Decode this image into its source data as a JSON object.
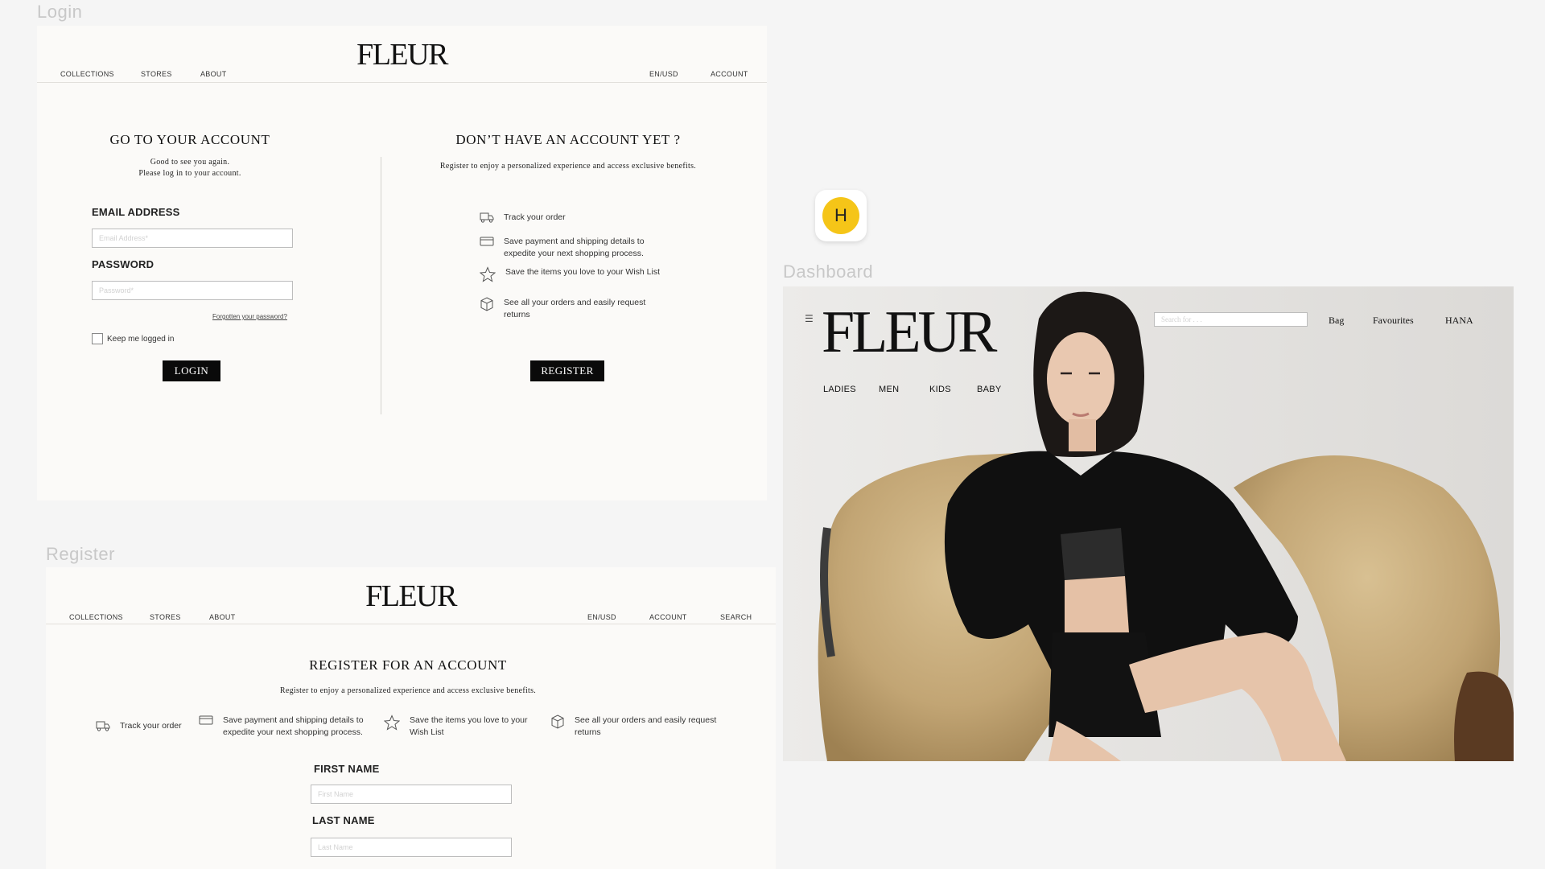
{
  "labels": {
    "login_frame": "Login",
    "register_frame": "Register",
    "dashboard_frame": "Dashboard"
  },
  "avatar": {
    "initial": "H",
    "color": "#f5c518"
  },
  "brand": {
    "logo": "FLEUR"
  },
  "login_page": {
    "nav_left": [
      "COLLECTIONS",
      "STORES",
      "ABOUT"
    ],
    "nav_right": [
      "EN/USD",
      "ACCOUNT"
    ],
    "login": {
      "title": "GO TO YOUR ACCOUNT",
      "subtitle_line1": "Good to see you again.",
      "subtitle_line2": "Please log in to your account.",
      "email_label": "EMAIL ADDRESS",
      "email_placeholder": "Email Address*",
      "password_label": "PASSWORD",
      "password_placeholder": "Password*",
      "forgot": "Forgotten your password?",
      "keep_logged": "Keep me logged in",
      "button": "LOGIN"
    },
    "signup": {
      "title": "DON’T HAVE AN ACCOUNT YET ?",
      "subtitle": "Register to enjoy a personalized experience and access exclusive benefits.",
      "benefits": [
        {
          "icon": "truck-icon",
          "text": "Track your order"
        },
        {
          "icon": "card-icon",
          "text": "Save payment and shipping details to expedite your next shopping process."
        },
        {
          "icon": "star-icon",
          "text": "Save the items you love to your Wish List"
        },
        {
          "icon": "box-icon",
          "text": "See all your orders and easily request returns"
        }
      ],
      "button": "REGISTER"
    }
  },
  "register_page": {
    "nav_left": [
      "COLLECTIONS",
      "STORES",
      "ABOUT"
    ],
    "nav_right": [
      "EN/USD",
      "ACCOUNT",
      "SEARCH"
    ],
    "title": "REGISTER FOR AN ACCOUNT",
    "subtitle": "Register to enjoy a personalized experience and access exclusive benefits.",
    "benefits": [
      {
        "icon": "truck-icon",
        "text": "Track your order"
      },
      {
        "icon": "card-icon",
        "text": "Save payment and shipping details to expedite your next shopping process."
      },
      {
        "icon": "star-icon",
        "text": "Save the items you love to your Wish List"
      },
      {
        "icon": "box-icon",
        "text": "See all your orders and easily request returns"
      }
    ],
    "first_name_label": "FIRST NAME",
    "first_name_placeholder": "First Name",
    "last_name_label": "LAST NAME",
    "last_name_placeholder": "Last Name"
  },
  "dashboard": {
    "search_placeholder": "Search for . . .",
    "nav": [
      "Bag",
      "Favourites",
      "HANA"
    ],
    "categories": [
      "LADIES",
      "MEN",
      "KIDS",
      "BABY"
    ]
  }
}
